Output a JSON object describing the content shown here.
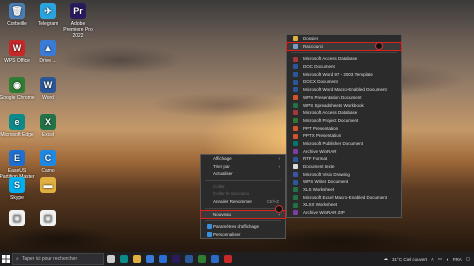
{
  "desktop_icons": [
    {
      "name": "corbeille",
      "label": "Corbeille",
      "color": "#4a7fb5",
      "glyph": "🗑"
    },
    {
      "name": "telegram",
      "label": "Telegram",
      "color": "#2aa3df",
      "glyph": "✈"
    },
    {
      "name": "premiere",
      "label": "Adobe Premiere Pro 2022",
      "color": "#2a1a5e",
      "glyph": "Pr"
    },
    {
      "name": "wps-office",
      "label": "WPS Office",
      "color": "#c62828",
      "glyph": "W"
    },
    {
      "name": "drive",
      "label": "Drive ...",
      "color": "#3b7bd8",
      "glyph": "▲"
    },
    {
      "name": "chrome",
      "label": "Google Chrome",
      "color": "#2e7d32",
      "glyph": "◉"
    },
    {
      "name": "word",
      "label": "Word",
      "color": "#2b579a",
      "glyph": "W"
    },
    {
      "name": "edge",
      "label": "Microsoft Edge",
      "color": "#0c8a8a",
      "glyph": "e"
    },
    {
      "name": "excel",
      "label": "Excel",
      "color": "#217346",
      "glyph": "X"
    },
    {
      "name": "easeus",
      "label": "EaseUS Partition Master",
      "color": "#1f6fd1",
      "glyph": "E"
    },
    {
      "name": "camo",
      "label": "Camo",
      "color": "#1e88e5",
      "glyph": "C"
    },
    {
      "name": "skype",
      "label": "Skype",
      "color": "#00aff0",
      "glyph": "S"
    },
    {
      "name": "folder",
      "label": "",
      "color": "#e0b040",
      "glyph": "▬"
    },
    {
      "name": "file1",
      "label": "",
      "color": "#f2f2f2",
      "glyph": "▢"
    },
    {
      "name": "file2",
      "label": "",
      "color": "#f2f2f2",
      "glyph": "▢"
    }
  ],
  "context_menu": {
    "items": [
      {
        "label": "Affichage",
        "arrow": "›",
        "disabled": false
      },
      {
        "label": "Trier par",
        "arrow": "›",
        "disabled": false
      },
      {
        "label": "Actualiser",
        "disabled": false
      },
      {
        "sep": true
      },
      {
        "label": "Coller",
        "disabled": true
      },
      {
        "label": "Coller le raccourci",
        "disabled": true
      },
      {
        "label": "Annuler Renommer",
        "shortcut": "Ctrl+Z",
        "disabled": false
      },
      {
        "sep": true
      },
      {
        "label": "Nouveau",
        "arrow": "›",
        "highlighted": true,
        "disabled": false
      },
      {
        "sep": true
      },
      {
        "label": "Paramètres d'affichage",
        "icon_color": "#3b8fe0",
        "disabled": false
      },
      {
        "label": "Personnaliser",
        "icon_color": "#3b8fe0",
        "disabled": false
      }
    ]
  },
  "submenu": {
    "items": [
      {
        "label": "Dossier",
        "icon_color": "#e0b040"
      },
      {
        "label": "Raccourci",
        "icon_color": "#7a9cc9",
        "highlighted": true
      },
      {
        "sep": true
      },
      {
        "label": "Microsoft Access Database",
        "icon_color": "#a4373a"
      },
      {
        "label": "DOC Document",
        "icon_color": "#2b579a"
      },
      {
        "label": "Microsoft Word 97 - 2003 Template",
        "icon_color": "#2b579a"
      },
      {
        "label": "DOCX Document",
        "icon_color": "#2b579a"
      },
      {
        "label": "Microsoft Word Macro-Enabled Document",
        "icon_color": "#2b579a"
      },
      {
        "label": "WPS Presentation Document",
        "icon_color": "#d35230"
      },
      {
        "label": "WPS Spreadsheets Workbook",
        "icon_color": "#217346"
      },
      {
        "label": "Microsoft Access Database",
        "icon_color": "#a4373a"
      },
      {
        "label": "Microsoft Project Document",
        "icon_color": "#31752f"
      },
      {
        "label": "PPT Presentation",
        "icon_color": "#d35230"
      },
      {
        "label": "PPTX Presentation",
        "icon_color": "#d35230"
      },
      {
        "label": "Microsoft Publisher Document",
        "icon_color": "#077568"
      },
      {
        "label": "Archive WinRAR",
        "icon_color": "#7b3fa0"
      },
      {
        "label": "RTF Format",
        "icon_color": "#2b579a"
      },
      {
        "label": "Document texte",
        "icon_color": "#dddddd"
      },
      {
        "label": "Microsoft Visio Drawing",
        "icon_color": "#3955a3"
      },
      {
        "label": "WPS Writer Document",
        "icon_color": "#2b579a"
      },
      {
        "label": "XLS Worksheet",
        "icon_color": "#217346"
      },
      {
        "label": "Microsoft Excel Macro-Enabled Document",
        "icon_color": "#217346"
      },
      {
        "label": "XLSX Worksheet",
        "icon_color": "#217346"
      },
      {
        "label": "Archive WinRAR ZIP",
        "icon_color": "#7b3fa0"
      }
    ]
  },
  "taskbar": {
    "search_placeholder": "Taper ici pour rechercher",
    "apps": [
      {
        "name": "task-view",
        "color": "#cccccc"
      },
      {
        "name": "edge",
        "color": "#0c8a8a"
      },
      {
        "name": "explorer",
        "color": "#e0b040"
      },
      {
        "name": "store",
        "color": "#3b7bd8"
      },
      {
        "name": "mail",
        "color": "#2a6fd6"
      },
      {
        "name": "premiere",
        "color": "#2a1a5e"
      },
      {
        "name": "word",
        "color": "#2b579a"
      },
      {
        "name": "chrome",
        "color": "#2e7d32"
      },
      {
        "name": "photos",
        "color": "#2b6bc6"
      },
      {
        "name": "wps",
        "color": "#c62828"
      }
    ],
    "weather": "31°C  Ciel couvert",
    "lang": "FRA"
  }
}
